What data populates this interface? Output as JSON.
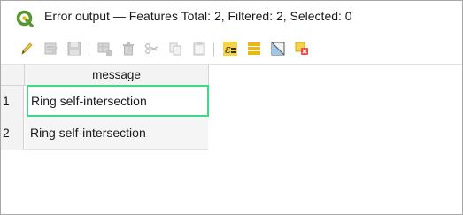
{
  "window": {
    "title": "Error output — Features Total: 2, Filtered: 2, Selected: 0"
  },
  "toolbar": {
    "buttons": [
      {
        "name": "toggle-editing",
        "icon": "pencil-icon"
      },
      {
        "name": "toggle-multi-edit",
        "icon": "multi-edit-icon"
      },
      {
        "name": "save-edits",
        "icon": "save-icon"
      },
      {
        "name": "add-feature",
        "icon": "add-feature-icon"
      },
      {
        "name": "delete-selected",
        "icon": "trash-icon"
      },
      {
        "name": "cut-selected",
        "icon": "scissors-icon"
      },
      {
        "name": "copy-selected",
        "icon": "copy-icon"
      },
      {
        "name": "paste-features",
        "icon": "paste-icon"
      },
      {
        "name": "select-by-expression",
        "icon": "select-expression-icon"
      },
      {
        "name": "select-all",
        "icon": "select-all-icon"
      },
      {
        "name": "invert-selection",
        "icon": "invert-selection-icon"
      },
      {
        "name": "deselect-all",
        "icon": "deselect-icon"
      }
    ]
  },
  "table": {
    "columns": [
      "message"
    ],
    "rows": [
      {
        "num": "1",
        "message": "Ring self-intersection"
      },
      {
        "num": "2",
        "message": "Ring self-intersection"
      }
    ],
    "selected_cell_border_color": "#3ddc84"
  },
  "colors": {
    "qgis_green": "#589632",
    "qgis_yellow": "#eeb51a",
    "toolbar_disabled": "#b8b8b8"
  }
}
